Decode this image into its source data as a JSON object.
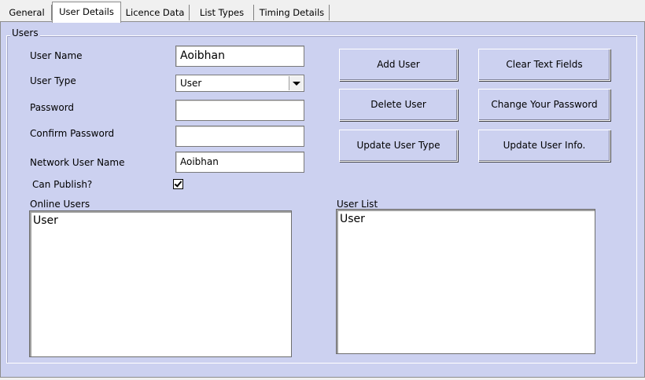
{
  "tabs": [
    "General",
    "User Details",
    "Licence Data",
    "List Types",
    "Timing Details"
  ],
  "active_tab": "User Details",
  "group_title": "Users",
  "form": {
    "user_name_label": "User Name",
    "user_name_value": "Aoibhan",
    "user_type_label": "User Type",
    "user_type_value": "User",
    "password_label": "Password",
    "password_value": "",
    "confirm_password_label": "Confirm Password",
    "confirm_password_value": "",
    "network_user_name_label": "Network User Name",
    "network_user_name_value": "Aoibhan",
    "can_publish_label": "Can Publish?",
    "can_publish_checked": true
  },
  "buttons": {
    "add_user": "Add User",
    "clear_text_fields": "Clear Text Fields",
    "delete_user": "Delete User",
    "change_password": "Change Your Password",
    "update_user_type": "Update User Type",
    "update_user_info": "Update User Info."
  },
  "online_users": {
    "label": "Online Users",
    "items": [
      "User"
    ]
  },
  "user_list": {
    "label": "User List",
    "items": [
      "User"
    ]
  }
}
